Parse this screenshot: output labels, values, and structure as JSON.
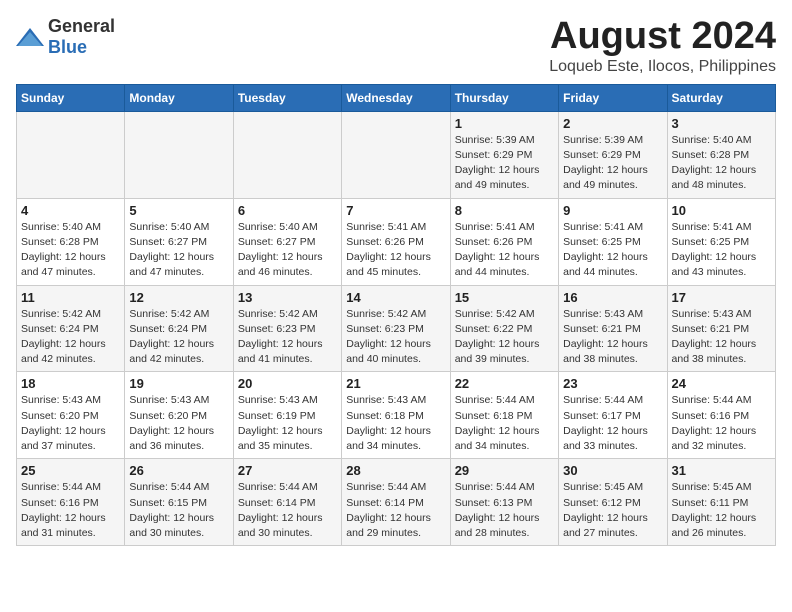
{
  "header": {
    "logo_general": "General",
    "logo_blue": "Blue",
    "title": "August 2024",
    "subtitle": "Loqueb Este, Ilocos, Philippines"
  },
  "days_of_week": [
    "Sunday",
    "Monday",
    "Tuesday",
    "Wednesday",
    "Thursday",
    "Friday",
    "Saturday"
  ],
  "weeks": [
    [
      {
        "day": "",
        "info": ""
      },
      {
        "day": "",
        "info": ""
      },
      {
        "day": "",
        "info": ""
      },
      {
        "day": "",
        "info": ""
      },
      {
        "day": "1",
        "info": "Sunrise: 5:39 AM\nSunset: 6:29 PM\nDaylight: 12 hours\nand 49 minutes."
      },
      {
        "day": "2",
        "info": "Sunrise: 5:39 AM\nSunset: 6:29 PM\nDaylight: 12 hours\nand 49 minutes."
      },
      {
        "day": "3",
        "info": "Sunrise: 5:40 AM\nSunset: 6:28 PM\nDaylight: 12 hours\nand 48 minutes."
      }
    ],
    [
      {
        "day": "4",
        "info": "Sunrise: 5:40 AM\nSunset: 6:28 PM\nDaylight: 12 hours\nand 47 minutes."
      },
      {
        "day": "5",
        "info": "Sunrise: 5:40 AM\nSunset: 6:27 PM\nDaylight: 12 hours\nand 47 minutes."
      },
      {
        "day": "6",
        "info": "Sunrise: 5:40 AM\nSunset: 6:27 PM\nDaylight: 12 hours\nand 46 minutes."
      },
      {
        "day": "7",
        "info": "Sunrise: 5:41 AM\nSunset: 6:26 PM\nDaylight: 12 hours\nand 45 minutes."
      },
      {
        "day": "8",
        "info": "Sunrise: 5:41 AM\nSunset: 6:26 PM\nDaylight: 12 hours\nand 44 minutes."
      },
      {
        "day": "9",
        "info": "Sunrise: 5:41 AM\nSunset: 6:25 PM\nDaylight: 12 hours\nand 44 minutes."
      },
      {
        "day": "10",
        "info": "Sunrise: 5:41 AM\nSunset: 6:25 PM\nDaylight: 12 hours\nand 43 minutes."
      }
    ],
    [
      {
        "day": "11",
        "info": "Sunrise: 5:42 AM\nSunset: 6:24 PM\nDaylight: 12 hours\nand 42 minutes."
      },
      {
        "day": "12",
        "info": "Sunrise: 5:42 AM\nSunset: 6:24 PM\nDaylight: 12 hours\nand 42 minutes."
      },
      {
        "day": "13",
        "info": "Sunrise: 5:42 AM\nSunset: 6:23 PM\nDaylight: 12 hours\nand 41 minutes."
      },
      {
        "day": "14",
        "info": "Sunrise: 5:42 AM\nSunset: 6:23 PM\nDaylight: 12 hours\nand 40 minutes."
      },
      {
        "day": "15",
        "info": "Sunrise: 5:42 AM\nSunset: 6:22 PM\nDaylight: 12 hours\nand 39 minutes."
      },
      {
        "day": "16",
        "info": "Sunrise: 5:43 AM\nSunset: 6:21 PM\nDaylight: 12 hours\nand 38 minutes."
      },
      {
        "day": "17",
        "info": "Sunrise: 5:43 AM\nSunset: 6:21 PM\nDaylight: 12 hours\nand 38 minutes."
      }
    ],
    [
      {
        "day": "18",
        "info": "Sunrise: 5:43 AM\nSunset: 6:20 PM\nDaylight: 12 hours\nand 37 minutes."
      },
      {
        "day": "19",
        "info": "Sunrise: 5:43 AM\nSunset: 6:20 PM\nDaylight: 12 hours\nand 36 minutes."
      },
      {
        "day": "20",
        "info": "Sunrise: 5:43 AM\nSunset: 6:19 PM\nDaylight: 12 hours\nand 35 minutes."
      },
      {
        "day": "21",
        "info": "Sunrise: 5:43 AM\nSunset: 6:18 PM\nDaylight: 12 hours\nand 34 minutes."
      },
      {
        "day": "22",
        "info": "Sunrise: 5:44 AM\nSunset: 6:18 PM\nDaylight: 12 hours\nand 34 minutes."
      },
      {
        "day": "23",
        "info": "Sunrise: 5:44 AM\nSunset: 6:17 PM\nDaylight: 12 hours\nand 33 minutes."
      },
      {
        "day": "24",
        "info": "Sunrise: 5:44 AM\nSunset: 6:16 PM\nDaylight: 12 hours\nand 32 minutes."
      }
    ],
    [
      {
        "day": "25",
        "info": "Sunrise: 5:44 AM\nSunset: 6:16 PM\nDaylight: 12 hours\nand 31 minutes."
      },
      {
        "day": "26",
        "info": "Sunrise: 5:44 AM\nSunset: 6:15 PM\nDaylight: 12 hours\nand 30 minutes."
      },
      {
        "day": "27",
        "info": "Sunrise: 5:44 AM\nSunset: 6:14 PM\nDaylight: 12 hours\nand 30 minutes."
      },
      {
        "day": "28",
        "info": "Sunrise: 5:44 AM\nSunset: 6:14 PM\nDaylight: 12 hours\nand 29 minutes."
      },
      {
        "day": "29",
        "info": "Sunrise: 5:44 AM\nSunset: 6:13 PM\nDaylight: 12 hours\nand 28 minutes."
      },
      {
        "day": "30",
        "info": "Sunrise: 5:45 AM\nSunset: 6:12 PM\nDaylight: 12 hours\nand 27 minutes."
      },
      {
        "day": "31",
        "info": "Sunrise: 5:45 AM\nSunset: 6:11 PM\nDaylight: 12 hours\nand 26 minutes."
      }
    ]
  ]
}
